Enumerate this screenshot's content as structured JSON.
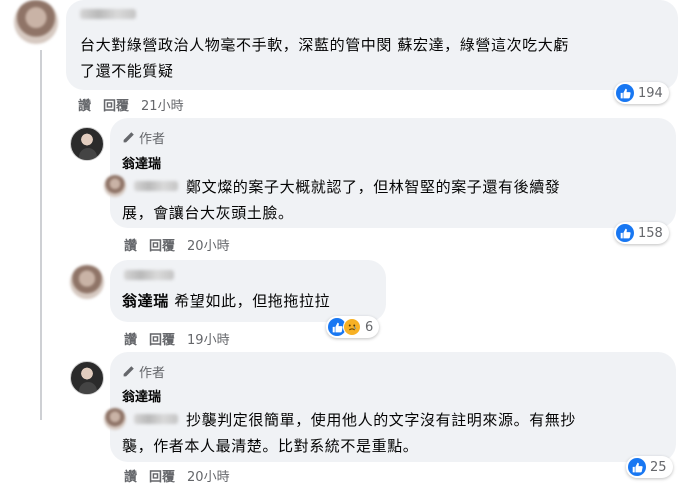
{
  "comments": [
    {
      "text_lines": [
        "台大對綠營政治人物毫不手軟，深藍的管中閔 蘇宏達，綠營這次吃大虧",
        "了還不能質疑"
      ],
      "actions": {
        "like": "讚",
        "reply": "回覆",
        "time": "21小時"
      },
      "reaction_count": "194"
    },
    {
      "author_badge": "作者",
      "author_name": "翁達瑞",
      "text_lines": [
        "鄭文燦的案子大概就認了，但林智堅的案子還有後續發",
        "展，會讓台大灰頭土臉。"
      ],
      "actions": {
        "like": "讚",
        "reply": "回覆",
        "time": "20小時"
      },
      "reaction_count": "158"
    },
    {
      "mention": "翁達瑞",
      "text": "希望如此，但拖拖拉拉",
      "actions": {
        "like": "讚",
        "reply": "回覆",
        "time": "19小時"
      },
      "reaction_count": "6"
    },
    {
      "author_badge": "作者",
      "author_name": "翁達瑞",
      "text_lines": [
        "抄襲判定很簡單，使用他人的文字沒有註明來源。有無抄",
        "襲，作者本人最清楚。比對系統不是重點。"
      ],
      "actions": {
        "like": "讚",
        "reply": "回覆",
        "time": "20小時"
      },
      "reaction_count": "25"
    }
  ],
  "colors": {
    "bubble": "#f0f2f5",
    "like": "#1877f2",
    "meta": "#65676b"
  }
}
